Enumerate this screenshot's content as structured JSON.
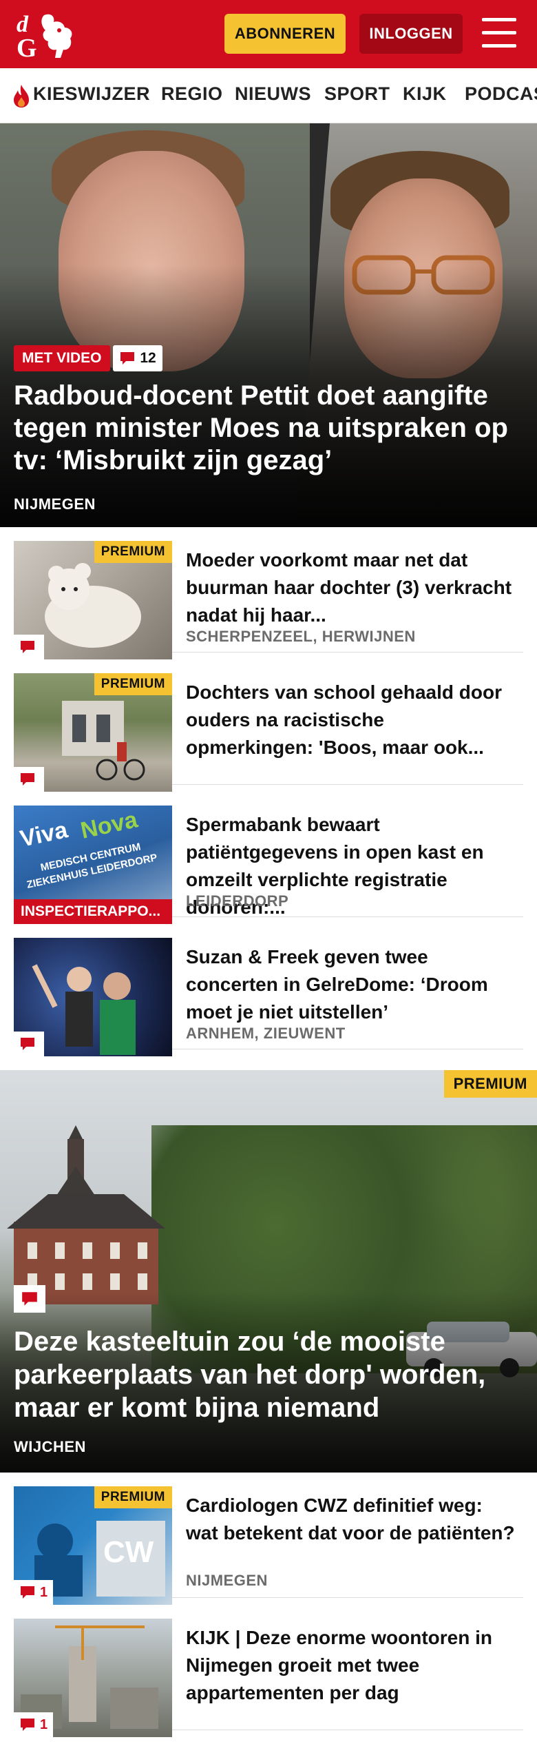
{
  "header": {
    "logo_text": "dG",
    "subscribe_label": "ABONNEREN",
    "login_label": "INLOGGEN",
    "brand_color": "#cf0d1f",
    "accent_color": "#f5c232"
  },
  "nav": {
    "items": [
      {
        "label": "KIESWIJZER",
        "icon": "flame-icon"
      },
      {
        "label": "REGIO"
      },
      {
        "label": "NIEUWS"
      },
      {
        "label": "SPORT"
      },
      {
        "label": "KIJK"
      },
      {
        "label": "PODCAS"
      }
    ]
  },
  "hero": {
    "badge": "MET VIDEO",
    "comments": "12",
    "title": "Radboud-docent Pettit doet aangifte tegen minister Moes na uitspraken op tv: ‘Misbruikt zijn gezag’",
    "location": "NIJMEGEN"
  },
  "articles": [
    {
      "premium": "PREMIUM",
      "title": "Moeder voorkomt maar net dat buurman haar dochter (3) verkracht nadat hij haar...",
      "location": "SCHERPENZEEL, HERWIJNEN",
      "comments": ""
    },
    {
      "premium": "PREMIUM",
      "title": "Dochters van school gehaald door ouders na racistische opmerkingen: 'Boos, maar ook...",
      "location": "",
      "comments": ""
    },
    {
      "badge": "INSPECTIERAPPO...",
      "title": "Spermabank bewaart patiëntgegevens in open kast en omzeilt verplichte registratie donoren:...",
      "location": "LEIDERDORP",
      "thumb_text": "Viva Nova · MEDISCH CENTRUM · ZIEKENHUIS LEIDERDORP"
    },
    {
      "title": "Suzan & Freek geven twee concerten in GelreDome: ‘Droom moet je niet uitstellen’",
      "location": "ARNHEM, ZIEUWENT",
      "comments": ""
    }
  ],
  "feature": {
    "premium": "PREMIUM",
    "title": "Deze kasteeltuin zou ‘de mooiste parkeerplaats van het dorp' worden, maar er komt bijna niemand",
    "location": "WIJCHEN"
  },
  "articles2": [
    {
      "premium": "PREMIUM",
      "title": "Cardiologen CWZ definitief weg: wat betekent dat voor de patiënten?",
      "location": "NIJMEGEN",
      "comments": "1"
    },
    {
      "title": "KIJK | Deze enorme woontoren in Nijmegen groeit met twee appartementen per dag",
      "location": "",
      "comments": "1"
    }
  ]
}
